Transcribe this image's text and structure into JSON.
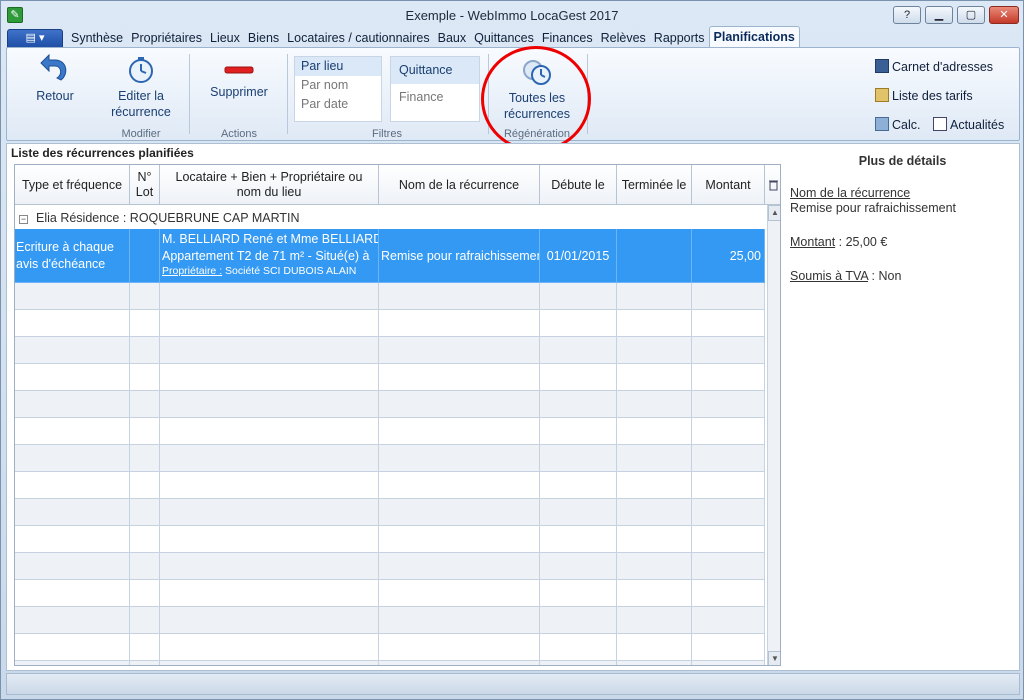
{
  "window": {
    "title": "Exemple - WebImmo LocaGest 2017",
    "buttons": [
      "?",
      "▁",
      "▢",
      "✕"
    ]
  },
  "tabs": [
    {
      "label": "Synthèse"
    },
    {
      "label": "Propriétaires"
    },
    {
      "label": "Lieux"
    },
    {
      "label": "Biens"
    },
    {
      "label": "Locataires / cautionnaires"
    },
    {
      "label": "Baux"
    },
    {
      "label": "Quittances"
    },
    {
      "label": "Finances"
    },
    {
      "label": "Relèves"
    },
    {
      "label": "Rapports"
    },
    {
      "label": "Planifications"
    }
  ],
  "ribbon": {
    "retour": "Retour",
    "editer": "Editer la récurrence",
    "modifier_label": "Modifier",
    "supprimer": "Supprimer",
    "actions_label": "Actions",
    "filter_lieu": [
      "Par lieu",
      "Par nom",
      "Par date"
    ],
    "filter_type": [
      "Quittance",
      "Finance"
    ],
    "filtres_label": "Filtres",
    "toutes": "Toutes les récurrences",
    "regeneration_label": "Régénération",
    "carnet": "Carnet d'adresses",
    "tarifs": "Liste des tarifs",
    "calc": "Calc.",
    "actualites": "Actualités"
  },
  "list": {
    "title": "Liste des récurrences planifiées",
    "headers": [
      "Type et fréquence",
      "N° Lot",
      "Locataire + Bien + Propriétaire ou nom du lieu",
      "Nom de la récurrence",
      "Débute le",
      "Terminée le",
      "Montant"
    ],
    "group": "Elia Résidence : ROQUEBRUNE CAP MARTIN",
    "row": {
      "type": "Ecriture à chaque avis d'échéance",
      "lot": "",
      "locataire_line1": "M. BELLIARD René et Mme BELLIARD",
      "locataire_line2": "Appartement T2 de 71 m² - Situé(e) à",
      "proprietaire_label": "Propriétaire :",
      "proprietaire_value": "Société SCI DUBOIS ALAIN",
      "nom": "Remise pour rafraichissement",
      "debut": "01/01/2015",
      "fin": "",
      "montant": "25,00"
    }
  },
  "details": {
    "title": "Plus de détails",
    "nom_label": "Nom de la récurrence",
    "nom_value": "Remise pour rafraichissement",
    "montant_label": "Montant",
    "montant_value": " : 25,00 €",
    "tva_label": "Soumis à TVA",
    "tva_value": " : Non"
  },
  "colors": {
    "selection": "#3399f3",
    "highlight_circle": "#e00000"
  }
}
